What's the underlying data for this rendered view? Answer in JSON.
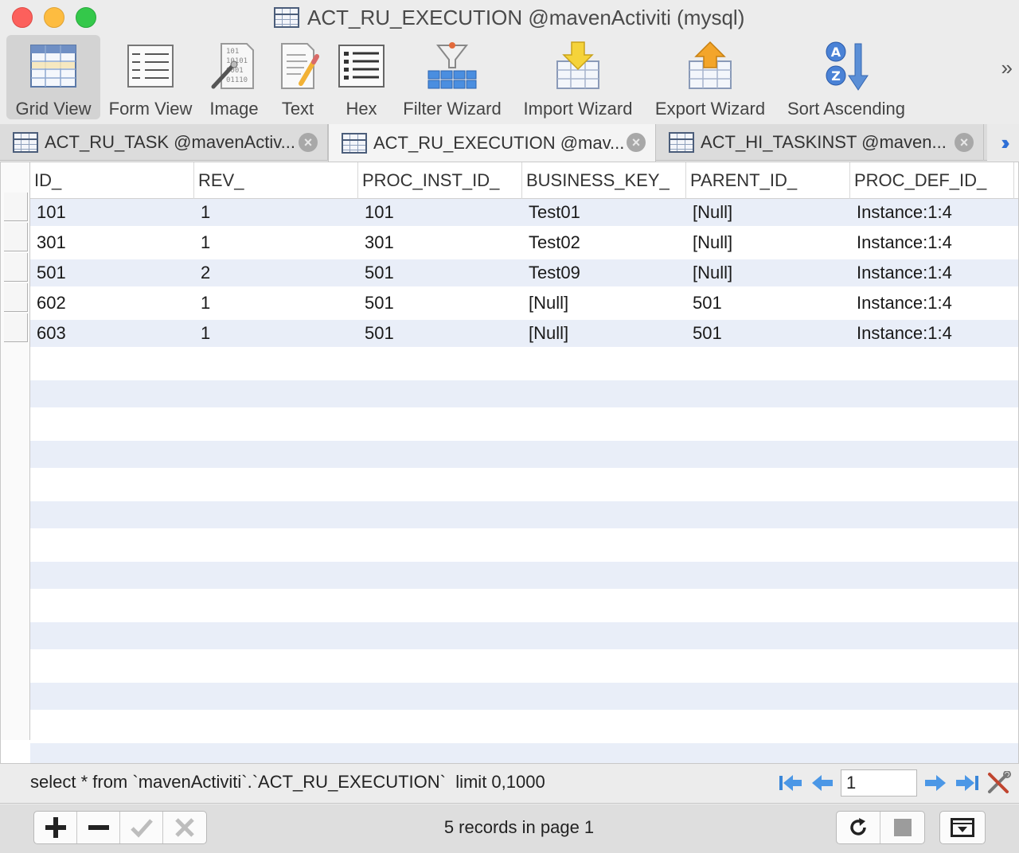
{
  "window": {
    "title": "ACT_RU_EXECUTION @mavenActiviti (mysql)"
  },
  "toolbar": {
    "items": [
      {
        "label": "Grid View",
        "icon": "grid-view-icon",
        "active": true
      },
      {
        "label": "Form View",
        "icon": "form-view-icon"
      },
      {
        "label": "Image",
        "icon": "image-icon"
      },
      {
        "label": "Text",
        "icon": "text-icon"
      },
      {
        "label": "Hex",
        "icon": "hex-icon"
      },
      {
        "label": "Filter Wizard",
        "icon": "filter-wizard-icon"
      },
      {
        "label": "Import Wizard",
        "icon": "import-wizard-icon"
      },
      {
        "label": "Export Wizard",
        "icon": "export-wizard-icon"
      },
      {
        "label": "Sort Ascending",
        "icon": "sort-ascending-icon"
      }
    ],
    "overflow": "»"
  },
  "tabs": [
    {
      "label": "ACT_RU_TASK @mavenActiv..."
    },
    {
      "label": "ACT_RU_EXECUTION @mav...",
      "active": true
    },
    {
      "label": "ACT_HI_TASKINST @maven..."
    }
  ],
  "table": {
    "columns": [
      "ID_",
      "REV_",
      "PROC_INST_ID_",
      "BUSINESS_KEY_",
      "PARENT_ID_",
      "PROC_DEF_ID_"
    ],
    "rows": [
      [
        "101",
        "1",
        "101",
        "Test01",
        "[Null]",
        "Instance:1:4"
      ],
      [
        "301",
        "1",
        "301",
        "Test02",
        "[Null]",
        "Instance:1:4"
      ],
      [
        "501",
        "2",
        "501",
        "Test09",
        "[Null]",
        "Instance:1:4"
      ],
      [
        "602",
        "1",
        "501",
        "[Null]",
        "501",
        "Instance:1:4"
      ],
      [
        "603",
        "1",
        "501",
        "[Null]",
        "501",
        "Instance:1:4"
      ]
    ]
  },
  "status": {
    "query": "select * from `mavenActiviti`.`ACT_RU_EXECUTION`  limit 0,1000",
    "page": "1",
    "records": "5 records in page 1"
  },
  "colors": {
    "stripe": "#e9eef8",
    "accent_blue": "#2f6fd6"
  }
}
